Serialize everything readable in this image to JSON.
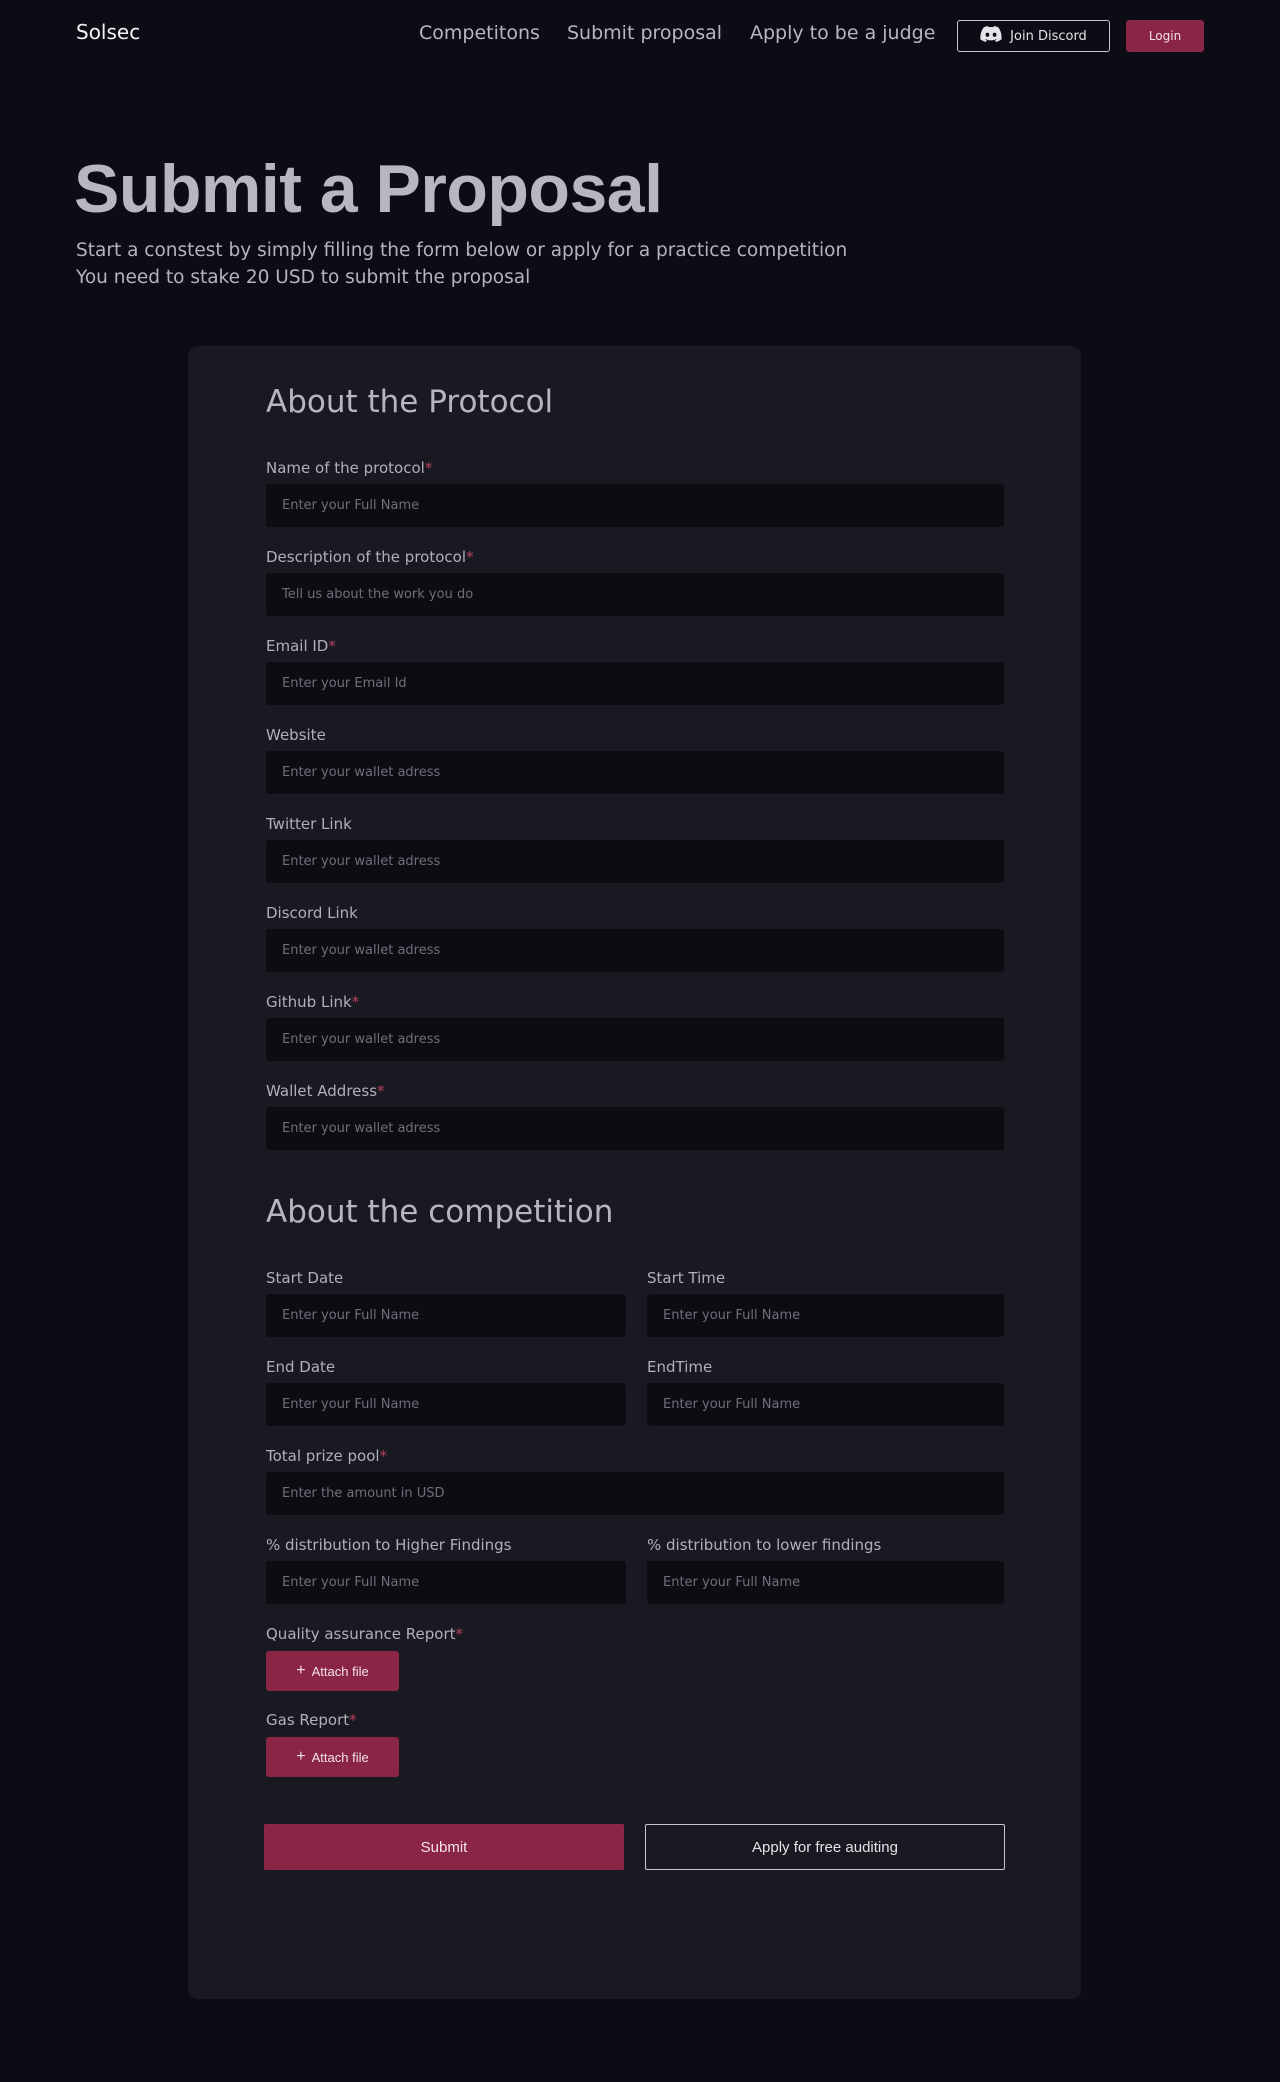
{
  "nav": {
    "logo": "Solsec",
    "links": [
      "Competitons",
      "Submit proposal",
      "Apply to be a judge"
    ],
    "discord_label": "Join Discord",
    "login_label": "Login"
  },
  "hero": {
    "title": "Submit a Proposal",
    "subtitle_line1": "Start a constest by simply filling the form below or apply for a practice competition",
    "subtitle_line2": "You need to stake 20 USD to submit the proposal"
  },
  "protocol_section": {
    "title": "About the Protocol",
    "fields": [
      {
        "label": "Name of the protocol",
        "required": "*",
        "placeholder": "Enter your Full Name",
        "value": ""
      },
      {
        "label": "Description of the protocol",
        "required": "*",
        "placeholder": "Tell us about the work you do",
        "value": ""
      },
      {
        "label": "Email ID",
        "required": "*",
        "placeholder": "Enter your Email Id",
        "value": ""
      },
      {
        "label": "Website",
        "required": "",
        "placeholder": "Enter your wallet adress",
        "value": ""
      },
      {
        "label": "Twitter Link",
        "required": "",
        "placeholder": "Enter your wallet adress",
        "value": ""
      },
      {
        "label": "Discord Link",
        "required": "",
        "placeholder": "Enter your wallet adress",
        "value": ""
      },
      {
        "label": "Github Link",
        "required": "*",
        "placeholder": "Enter your wallet adress",
        "value": ""
      },
      {
        "label": "Wallet Address",
        "required": "*",
        "placeholder": "Enter your wallet adress",
        "value": ""
      }
    ]
  },
  "competition_section": {
    "title": "About the competition",
    "start_date": {
      "label": "Start Date",
      "placeholder": "Enter your Full Name"
    },
    "start_time": {
      "label": "Start Time",
      "placeholder": "Enter your Full Name"
    },
    "end_date": {
      "label": "End Date",
      "placeholder": "Enter your Full Name"
    },
    "end_time": {
      "label": "EndTime",
      "placeholder": "Enter your Full Name"
    },
    "prize_pool": {
      "label": "Total prize pool",
      "required": "*",
      "placeholder": "Enter the amount in USD"
    },
    "higher_dist": {
      "label": "% distribution to Higher Findings",
      "placeholder": "Enter your Full Name"
    },
    "lower_dist": {
      "label": "% distribution to lower findings",
      "placeholder": "Enter your Full Name"
    },
    "qa_report": {
      "label": "Quality assurance Report",
      "required": "*",
      "button": "Attach file"
    },
    "gas_report": {
      "label": "Gas Report",
      "required": "*",
      "button": "Attach file"
    }
  },
  "actions": {
    "submit_label": "Submit",
    "free_label": "Apply for free auditing"
  },
  "colors": {
    "background": "#0c0c14",
    "card": "#191921",
    "accent": "#8b2545",
    "required": "#b8405f"
  }
}
